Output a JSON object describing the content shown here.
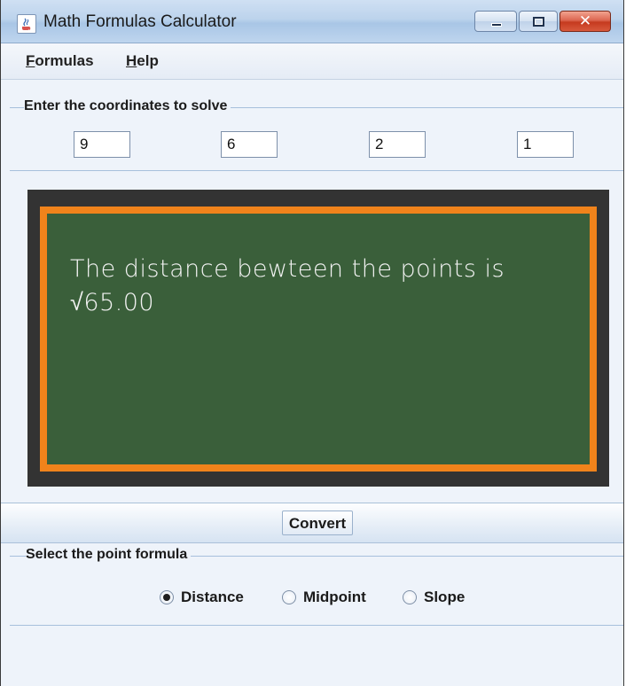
{
  "window": {
    "title": "Math Formulas Calculator",
    "close_glyph": "✕"
  },
  "menu": {
    "formulas": {
      "mnemonic": "F",
      "rest": "ormulas"
    },
    "help": {
      "mnemonic": "H",
      "rest": "elp"
    }
  },
  "coordinates": {
    "group_title": "Enter the coordinates to solve",
    "values": [
      "9",
      "6",
      "2",
      "1"
    ]
  },
  "board": {
    "line1": "The distance bewteen the points is",
    "line2": "√65.00"
  },
  "convert_label": "Convert",
  "formula_group": {
    "title": "Select the point formula",
    "options": [
      {
        "label": "Distance",
        "selected": true
      },
      {
        "label": "Midpoint",
        "selected": false
      },
      {
        "label": "Slope",
        "selected": false
      }
    ]
  }
}
